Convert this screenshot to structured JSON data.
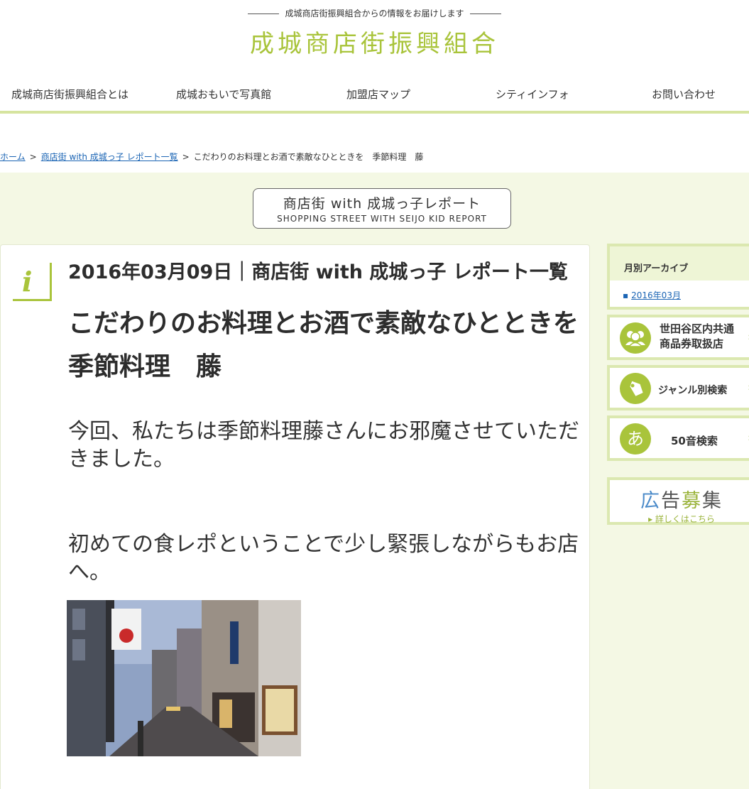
{
  "header": {
    "tagline": "成城商店街振興組合からの情報をお届けします",
    "site_title": "成城商店街振興組合"
  },
  "nav": {
    "items": [
      {
        "label": "成城商店街振興組合とは"
      },
      {
        "label": "成城おもいで写真館"
      },
      {
        "label": "加盟店マップ"
      },
      {
        "label": "シティインフォ"
      },
      {
        "label": "お問い合わせ"
      }
    ]
  },
  "breadcrumb": {
    "home": "ホーム",
    "sep": ">",
    "list": "商店街 with 成城っ子 レポート一覧",
    "current": "こだわりのお料理とお酒で素敵なひとときを　季節料理　藤"
  },
  "banner": {
    "jp": "商店街 with 成城っ子レポート",
    "en": "SHOPPING STREET WITH SEIJO KID REPORT"
  },
  "article": {
    "icon_glyph": "i",
    "meta": "2016年03月09日｜商店街 with 成城っ子 レポート一覧",
    "title": "こだわりのお料理とお酒で素敵なひとときを　季節料理　藤",
    "paragraphs": [
      "今回、私たちは季節料理藤さんにお邪魔させていただきました。",
      "初めての食レポということで少し緊張しながらもお店へ。"
    ],
    "photo_icon": "street-photo"
  },
  "sidebar": {
    "archive_heading": "月別アーカイブ",
    "archive_items": [
      "2016年03月"
    ],
    "btn_voucher": {
      "line1": "世田谷区内共通",
      "line2": "商品券取扱店",
      "icon": "people-icon"
    },
    "btn_genre": {
      "label": "ジャンル別検索",
      "icon": "tag-icon"
    },
    "btn_kana": {
      "glyph": "あ",
      "label": "50音検索"
    },
    "ad": {
      "c1": "広",
      "c2": "告",
      "c3": "募",
      "c4": "集",
      "link": "▸ 詳しくはこちら"
    },
    "arrow": "›"
  },
  "colors": {
    "accent": "#a9c43b",
    "band": "#f4f8e4",
    "link": "#1a64b4"
  }
}
